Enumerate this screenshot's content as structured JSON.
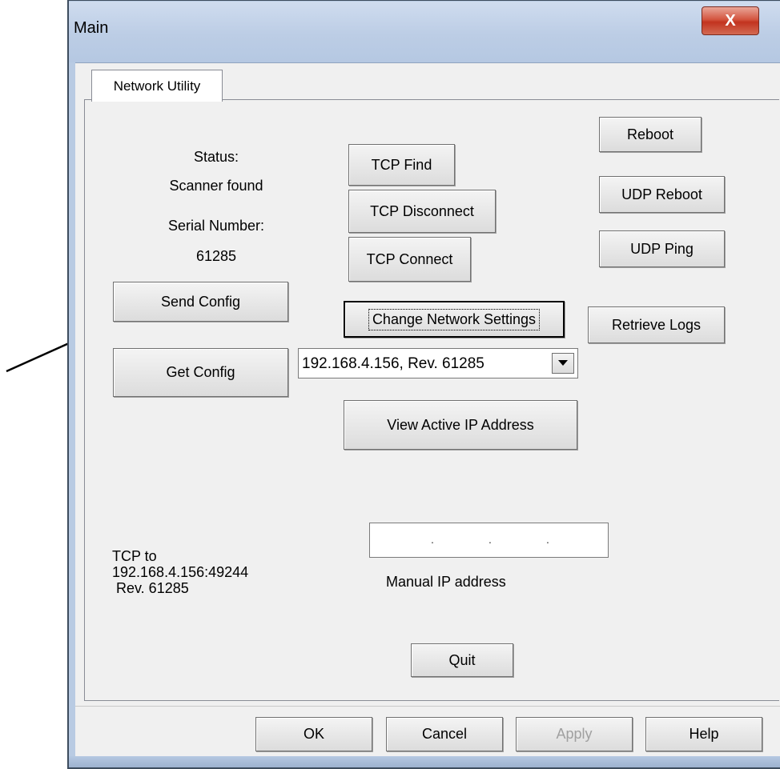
{
  "window": {
    "title": "Main",
    "close_glyph": "X"
  },
  "tabs": [
    {
      "label": "Network Utility",
      "active": true
    }
  ],
  "status": {
    "status_label": "Status:",
    "status_value": "Scanner found",
    "serial_label": "Serial Number:",
    "serial_value": "61285"
  },
  "buttons": {
    "send_config": "Send Config",
    "get_config": "Get Config",
    "tcp_find": "TCP Find",
    "tcp_disconnect": "TCP Disconnect",
    "tcp_connect": "TCP Connect",
    "change_network_settings": "Change Network Settings",
    "view_active_ip": "View Active IP Address",
    "reboot": "Reboot",
    "udp_reboot": "UDP Reboot",
    "udp_ping": "UDP Ping",
    "retrieve_logs": "Retrieve Logs",
    "quit": "Quit"
  },
  "device_select": {
    "selected": "192.168.4.156, Rev. 61285"
  },
  "manual_ip": {
    "value": "",
    "label": "Manual IP address"
  },
  "connection_info": {
    "line1": "TCP to",
    "line2": "192.168.4.156:49244",
    "line3": " Rev. 61285"
  },
  "dialog_buttons": {
    "ok": "OK",
    "cancel": "Cancel",
    "apply": "Apply",
    "help": "Help"
  },
  "colors": {
    "window_frame": "#b9cbe3",
    "close_button": "#c2331f",
    "dialog_bg": "#f0f0f0"
  }
}
